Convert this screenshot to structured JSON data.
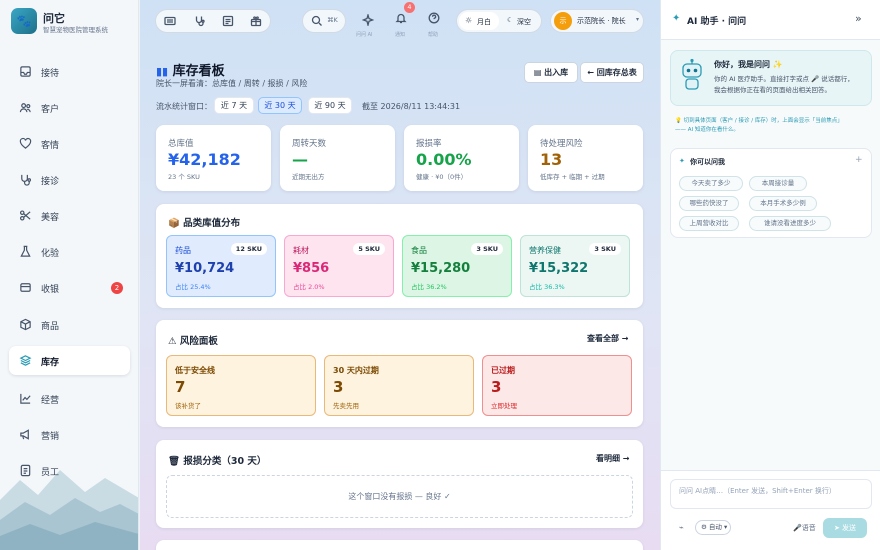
{
  "brand": {
    "name": "问它",
    "subtitle": "智慧宠物医院管理系统"
  },
  "sidebar": {
    "items": [
      {
        "label": "接待",
        "icon": "reception-icon"
      },
      {
        "label": "客户",
        "icon": "users-icon"
      },
      {
        "label": "客情",
        "icon": "heart-icon"
      },
      {
        "label": "接诊",
        "icon": "stethoscope-icon"
      },
      {
        "label": "美容",
        "icon": "scissors-icon"
      },
      {
        "label": "化验",
        "icon": "flask-icon"
      },
      {
        "label": "收银",
        "icon": "cashier-icon",
        "badge": "2"
      },
      {
        "label": "商品",
        "icon": "box-icon"
      },
      {
        "label": "库存",
        "icon": "stack-icon",
        "active": true
      },
      {
        "label": "经营",
        "icon": "trend-icon"
      },
      {
        "label": "营销",
        "icon": "megaphone-icon"
      },
      {
        "label": "员工",
        "icon": "id-card-icon"
      }
    ]
  },
  "topbar": {
    "search_label": "⌘K",
    "ai_label": "问问 AI",
    "notice_label": "通知",
    "notice_badge": "4",
    "help_label": "帮助",
    "theme_light": "月白",
    "theme_dark": "深空",
    "user_label": "示范院长 · 院长",
    "avatar_text": "示"
  },
  "page": {
    "title": "库存看板",
    "subtitle": "院长一屏看清：总库值 / 周转 / 报损 / 风险",
    "btn_inout": "出入库",
    "btn_back": "← 回库存总表",
    "window_label": "流水统计窗口：",
    "windows": [
      "近 7 天",
      "近 30 天",
      "近 90 天"
    ],
    "cutoff": "截至 2026/8/11 13:44:31"
  },
  "kpis": [
    {
      "label": "总库值",
      "value": "¥42,182",
      "sub": "23 个 SKU",
      "color": "#2563eb"
    },
    {
      "label": "周转天数",
      "value": "—",
      "sub": "近期无出方",
      "color": "#16a34a"
    },
    {
      "label": "报损率",
      "value": "0.00%",
      "sub": "健康 · ¥0（0件）",
      "color": "#16a34a"
    },
    {
      "label": "待处理风险",
      "value": "13",
      "sub": "低库存 + 临期 + 过期",
      "color": "#a16207"
    }
  ],
  "category": {
    "title": "品类库值分布",
    "items": [
      {
        "name": "药品",
        "sku": "12 SKU",
        "value": "¥10,724",
        "share": "占比 25.4%"
      },
      {
        "name": "耗材",
        "sku": "5 SKU",
        "value": "¥856",
        "share": "占比 2.0%"
      },
      {
        "name": "食品",
        "sku": "3 SKU",
        "value": "¥15,280",
        "share": "占比 36.2%"
      },
      {
        "name": "营养保健",
        "sku": "3 SKU",
        "value": "¥15,322",
        "share": "占比 36.3%"
      }
    ]
  },
  "risk": {
    "title": "风险面板",
    "link": "查看全部 →",
    "items": [
      {
        "name": "低于安全线",
        "value": "7",
        "sub": "该补货了"
      },
      {
        "name": "30 天内过期",
        "value": "3",
        "sub": "先卖先用"
      },
      {
        "name": "已过期",
        "value": "3",
        "sub": "立即处理"
      }
    ]
  },
  "loss": {
    "title": "报损分类（30 天）",
    "link": "看明细 →",
    "empty": "这个窗口没有报损 — 良好 ✓"
  },
  "ai": {
    "title": "AI 助手 · 问问",
    "greeting_title": "你好，我是问问 ✨",
    "greeting_line1": "你的 AI 医疗助手。直接打字或点 🎤 说话都行，",
    "greeting_line2": "我会根据你正在看的页面给出相关回答。",
    "hint_line1": "💡 切到具体页面（客户 / 接诊 / 库存）时，上面会显示「当前焦点」",
    "hint_line2": "—— AI 知道你在看什么。",
    "suggest_title": "你可以问我",
    "suggestions": [
      "今天卖了多少",
      "本周接诊量",
      "哪些药快没了",
      "本月手术多少例",
      "上周营收对比",
      "谁请没看进度多少"
    ],
    "input_placeholder": "问问 AI点睛…（Enter 发送，Shift+Enter 换行）",
    "mode_label": "自动",
    "voice_label": "语音",
    "send_label": "发送"
  },
  "colors": {
    "accent": "#2a9bb5",
    "primary_blue": "#2563eb",
    "green": "#16a34a",
    "amber": "#a16207",
    "danger": "#ef4444"
  }
}
